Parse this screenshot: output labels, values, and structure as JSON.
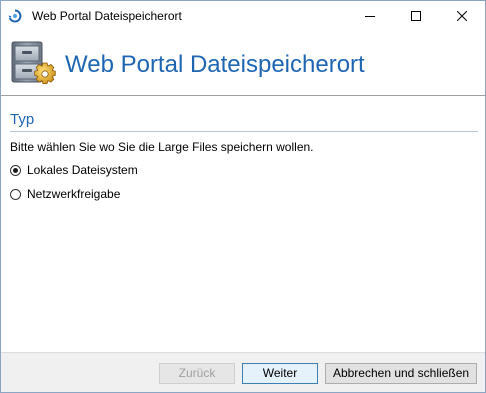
{
  "window": {
    "title": "Web Portal Dateispeicherort",
    "icon": "app-icon",
    "controls": {
      "minimize_icon": "minimize-icon",
      "maximize_icon": "maximize-icon",
      "close_icon": "close-icon"
    }
  },
  "header": {
    "title": "Web Portal Dateispeicherort",
    "icon": "file-cabinet-gear-icon"
  },
  "section": {
    "title": "Typ",
    "prompt": "Bitte wählen Sie wo Sie die Large Files speichern wollen."
  },
  "options": [
    {
      "label": "Lokales Dateisystem",
      "checked": true
    },
    {
      "label": "Netzwerkfreigabe",
      "checked": false
    }
  ],
  "footer": {
    "back_label": "Zurück",
    "back_enabled": false,
    "next_label": "Weiter",
    "cancel_label": "Abbrechen und schließen"
  },
  "colors": {
    "accent": "#1e66b2",
    "footer_bg": "#f0f0f0",
    "default_button_border": "#3c7fb1"
  }
}
